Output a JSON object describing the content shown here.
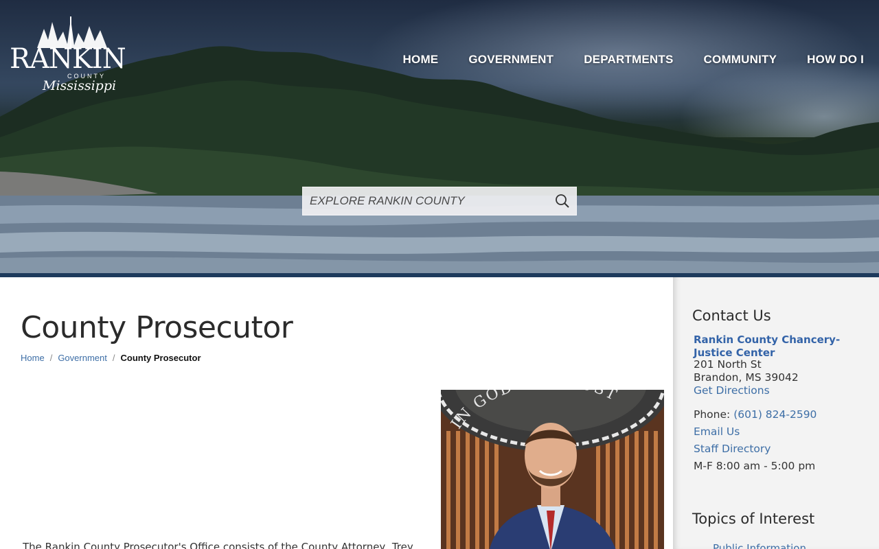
{
  "header": {
    "logo_text": "RANKIN",
    "logo_sub": "COUNTY",
    "logo_script": "Mississippi",
    "nav": [
      {
        "label": "HOME"
      },
      {
        "label": "GOVERNMENT"
      },
      {
        "label": "DEPARTMENTS"
      },
      {
        "label": "COMMUNITY"
      },
      {
        "label": "HOW DO I"
      }
    ]
  },
  "search": {
    "placeholder": "EXPLORE RANKIN COUNTY",
    "icon": "search-icon"
  },
  "main": {
    "title": "County Prosecutor",
    "breadcrumb": {
      "home": "Home",
      "government": "Government",
      "current": "County Prosecutor",
      "separator": "/"
    },
    "portrait_seal_text": "IN GOD WE TRUST",
    "intro": "The Rankin County Prosecutor's Office consists of the County Attorney, Trey"
  },
  "sidebar": {
    "contact_heading": "Contact Us",
    "org_name": "Rankin County Chancery-Justice Center",
    "address1": "201 North St",
    "address2": "Brandon, MS 39042",
    "directions": "Get Directions",
    "phone_label": "Phone:",
    "phone": "(601) 824-2590",
    "email": "Email Us",
    "staff": "Staff Directory",
    "hours": "M-F 8:00 am - 5:00 pm",
    "topics_heading": "Topics of Interest",
    "topic_1": "Public Information"
  },
  "colors": {
    "accent_blue": "#3d6ea6",
    "header_border": "#1d3a5c"
  }
}
